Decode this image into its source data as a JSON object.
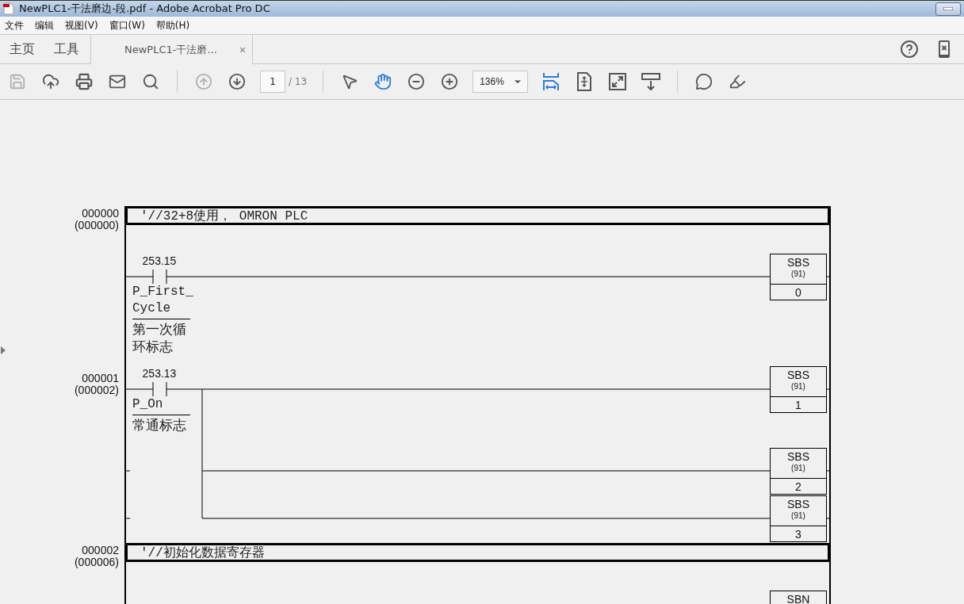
{
  "window": {
    "title": "NewPLC1-干法磨边-段.pdf - Adobe Acrobat Pro DC"
  },
  "menu": [
    "文件",
    "编辑",
    "视图(V)",
    "窗口(W)",
    "帮助(H)"
  ],
  "tabs": [
    {
      "label": "主页",
      "kind": "nav",
      "selected": false
    },
    {
      "label": "工具",
      "kind": "nav",
      "selected": false
    },
    {
      "label": "NewPLC1-干法磨...",
      "kind": "document",
      "selected": true,
      "close": "×"
    }
  ],
  "toolbar": [
    {
      "kind": "save",
      "disabled": true,
      "selected": false
    },
    {
      "kind": "upload",
      "disabled": false,
      "selected": false
    },
    {
      "kind": "print",
      "disabled": false,
      "selected": false
    },
    {
      "kind": "mail",
      "disabled": false,
      "selected": false
    },
    {
      "kind": "search",
      "disabled": false,
      "selected": false
    },
    {
      "kind": "separator"
    },
    {
      "kind": "prev",
      "disabled": true,
      "selected": false
    },
    {
      "kind": "next",
      "disabled": false,
      "selected": false
    },
    {
      "kind": "page",
      "value": "1",
      "total": "/ 13"
    },
    {
      "kind": "separator"
    },
    {
      "kind": "pointer",
      "disabled": false,
      "selected": false
    },
    {
      "kind": "hand",
      "disabled": false,
      "selected": true
    },
    {
      "kind": "zoom_out",
      "disabled": false,
      "selected": false
    },
    {
      "kind": "zoom_in",
      "disabled": false,
      "selected": false
    },
    {
      "kind": "zoom",
      "value": "136%"
    },
    {
      "kind": "fit_width",
      "disabled": false,
      "selected": true
    },
    {
      "kind": "fit_page",
      "disabled": false,
      "selected": false
    },
    {
      "kind": "fullscreen",
      "disabled": false,
      "selected": false
    },
    {
      "kind": "read_mode",
      "disabled": false,
      "selected": false
    },
    {
      "kind": "separator"
    },
    {
      "kind": "comment",
      "disabled": false,
      "selected": false
    },
    {
      "kind": "highlight",
      "disabled": false,
      "selected": false
    }
  ],
  "ladder": {
    "rungs": [
      {
        "number": "000000",
        "address": "(000000)",
        "comment": "'//32+8使用， OMRON PLC",
        "contact": {
          "address": "253.15",
          "name": "P_First_Cycle",
          "comment": "第一次循环标志"
        },
        "outputs": [
          {
            "instruction": "SBS",
            "code": "(91)",
            "operand": "0"
          }
        ]
      },
      {
        "number": "000001",
        "address": "(000002)",
        "contact": {
          "address": "253.13",
          "name": "P_On",
          "comment": "常通标志"
        },
        "outputs": [
          {
            "instruction": "SBS",
            "code": "(91)",
            "operand": "1"
          },
          {
            "instruction": "SBS",
            "code": "(91)",
            "operand": "2"
          },
          {
            "instruction": "SBS",
            "code": "(91)",
            "operand": "3"
          }
        ]
      },
      {
        "number": "000002",
        "address": "(000006)",
        "comment": "'//初始化数据寄存器",
        "outputs": [
          {
            "instruction": "SBN"
          }
        ]
      }
    ]
  }
}
